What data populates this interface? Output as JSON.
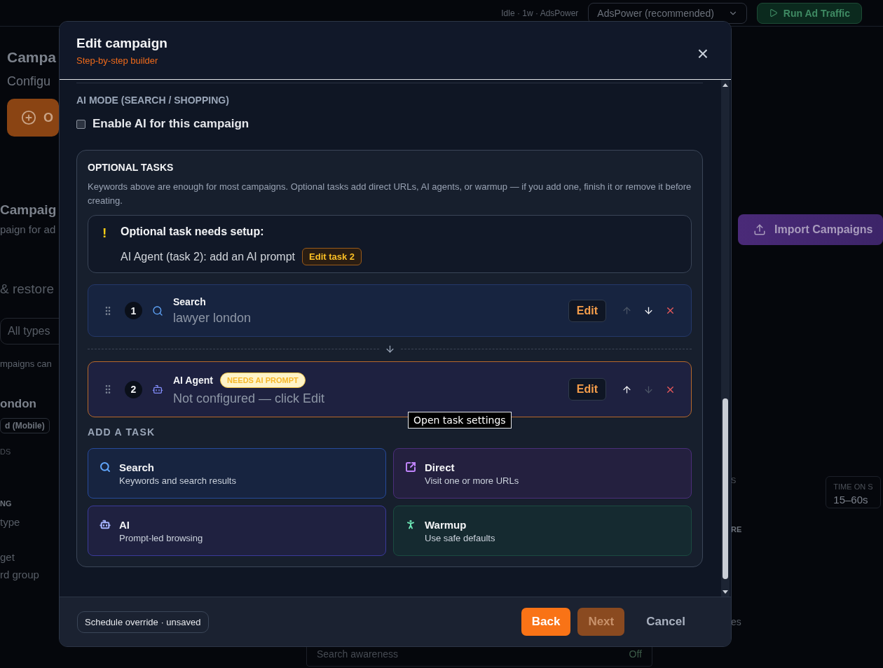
{
  "background": {
    "top_bar": {
      "status": "Idle · 1w · AdsPower",
      "browser_select": "AdsPower (recommended)",
      "run_button": "Run Ad Traffic"
    },
    "left": {
      "title": "Campa",
      "subtitle": "Configu",
      "create_button": "O",
      "section_title": "Campaig",
      "section_subtitle": "paign for ad",
      "restore_text": "& restore",
      "type_filter": "All types",
      "note": "mpaigns can",
      "campaign_name": "ondon",
      "device_tag": "d (Mobile)",
      "stat_label": "DS",
      "setting_label": "NG",
      "setting_1": "type",
      "setting_2": "get",
      "setting_3": "rd group"
    },
    "right": {
      "import_button": "Import Campaigns",
      "stat_label_1": "S",
      "stat_label_2": "TIME ON S",
      "stat_value_2": "15–60s",
      "setting_label": "RE",
      "setting_1": "es"
    },
    "bottom": {
      "row_label": "Search awareness",
      "row_value": "Off"
    }
  },
  "modal": {
    "title": "Edit campaign",
    "subtitle": "Step-by-step builder",
    "close": "×",
    "ai_mode": {
      "heading": "AI MODE (SEARCH / SHOPPING)",
      "checkbox_label": "Enable AI for this campaign",
      "checked": false
    },
    "optional_tasks": {
      "heading": "OPTIONAL TASKS",
      "description": "Keywords above are enough for most campaigns. Optional tasks add direct URLs, AI agents, or warmup — if you add one, finish it or remove it before creating.",
      "warning": {
        "icon": "!",
        "title": "Optional task needs setup:",
        "message": "AI Agent (task 2): add an AI prompt",
        "action": "Edit task 2"
      },
      "tasks": [
        {
          "kind": "search",
          "number": "1",
          "title": "Search",
          "detail": "lawyer london",
          "needs_setup": false,
          "edit": "Edit",
          "can_move_up": false,
          "can_move_down": true
        },
        {
          "kind": "ai",
          "number": "2",
          "title": "AI Agent",
          "badge": "NEEDS AI PROMPT",
          "detail": "Not configured — click Edit",
          "needs_setup": true,
          "edit": "Edit",
          "can_move_up": true,
          "can_move_down": false
        }
      ],
      "tooltip": "Open task settings",
      "add_heading": "ADD A TASK",
      "add_options": [
        {
          "kind": "search",
          "title": "Search",
          "description": "Keywords and search results",
          "color": "#60a5fa"
        },
        {
          "kind": "direct",
          "title": "Direct",
          "description": "Visit one or more URLs",
          "color": "#c084fc"
        },
        {
          "kind": "ai",
          "title": "AI",
          "description": "Prompt-led browsing",
          "color": "#a5b4fc"
        },
        {
          "kind": "warmup",
          "title": "Warmup",
          "description": "Use safe defaults",
          "color": "#6ee7b7"
        }
      ]
    },
    "footer": {
      "status": "Schedule override · unsaved",
      "back": "Back",
      "next": "Next",
      "next_disabled": true,
      "cancel": "Cancel"
    }
  }
}
